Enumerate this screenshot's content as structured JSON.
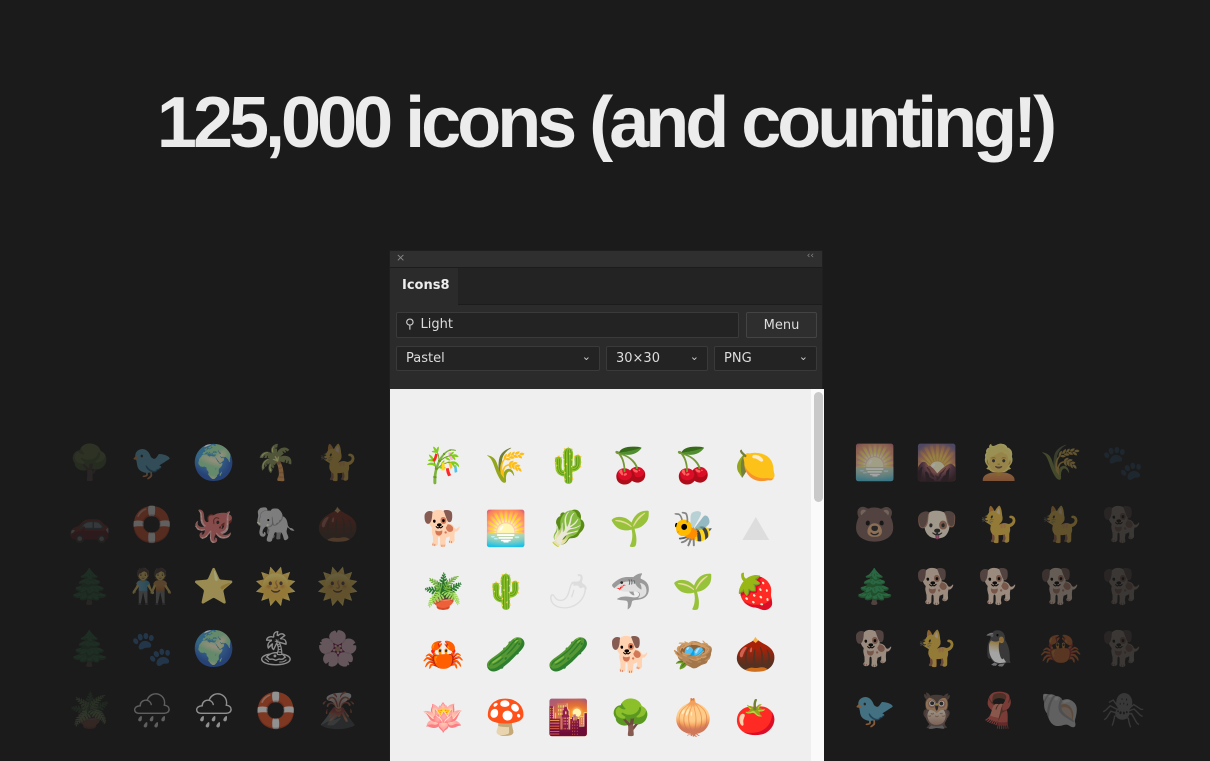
{
  "headline": "125,000 icons (and counting!)",
  "panel": {
    "close_icon": "×",
    "collapse_icon": "‹‹",
    "tab": "Icons8",
    "search": {
      "value": "Light",
      "icon": "search-icon"
    },
    "menu_label": "Menu",
    "style_select": "Pastel",
    "size_select": "30×30",
    "format_select": "PNG",
    "chevron": "⌄",
    "icons": [
      {
        "name": "bamboo",
        "g": "🎋"
      },
      {
        "name": "grass",
        "g": "🌾"
      },
      {
        "name": "cactus",
        "g": "🌵"
      },
      {
        "name": "cherry",
        "g": "🍒"
      },
      {
        "name": "cherries",
        "g": "🍒"
      },
      {
        "name": "lemon",
        "g": "🍋"
      },
      {
        "name": "dog",
        "g": "🐕"
      },
      {
        "name": "sunrise",
        "g": "🌅"
      },
      {
        "name": "lettuce",
        "g": "🥬"
      },
      {
        "name": "hand-plant",
        "g": "🌱"
      },
      {
        "name": "beehive",
        "g": "🐝"
      },
      {
        "name": "mountain",
        "g": "⛰"
      },
      {
        "name": "potted-plant",
        "g": "🪴"
      },
      {
        "name": "cactus-pot",
        "g": "🌵"
      },
      {
        "name": "radish",
        "g": "🌶"
      },
      {
        "name": "shark",
        "g": "🦈"
      },
      {
        "name": "sprout",
        "g": "🌱"
      },
      {
        "name": "strawberry",
        "g": "🍓"
      },
      {
        "name": "crab",
        "g": "🦀"
      },
      {
        "name": "cucumber",
        "g": "🥒"
      },
      {
        "name": "cucumbers",
        "g": "🥒"
      },
      {
        "name": "dog-2",
        "g": "🐕"
      },
      {
        "name": "nest",
        "g": "🪺"
      },
      {
        "name": "acorn",
        "g": "🌰"
      },
      {
        "name": "lotus",
        "g": "🪷"
      },
      {
        "name": "mushrooms",
        "g": "🍄"
      },
      {
        "name": "sunset",
        "g": "🌇"
      },
      {
        "name": "tree",
        "g": "🌳"
      },
      {
        "name": "onion",
        "g": "🧅"
      },
      {
        "name": "tomato",
        "g": "🍅"
      }
    ]
  },
  "side_left": [
    "🌳",
    "🐦",
    "🌍",
    "🌴",
    "🐈",
    "🚗",
    "🛟",
    "🐙",
    "🐘",
    "🌰",
    "🌲",
    "🧑‍🤝‍🧑",
    "⭐",
    "🌞",
    "🌞",
    "🌲",
    "🐾",
    "🌍",
    "🏝",
    "🌸",
    "🪴",
    "🌧",
    "🌧",
    "🛟",
    "🌋"
  ],
  "side_right": [
    "🌅",
    "🌄",
    "👱",
    "🌾",
    "🐾",
    "🐻",
    "🐶",
    "🐈",
    "🐈",
    "🐕",
    "🌲",
    "🐕",
    "🐕",
    "🐕",
    "🐕",
    "🐕",
    "🐈",
    "🐧",
    "🦀",
    "🐕",
    "🐦",
    "🦉",
    "🧣",
    "🐚",
    "🕷"
  ]
}
